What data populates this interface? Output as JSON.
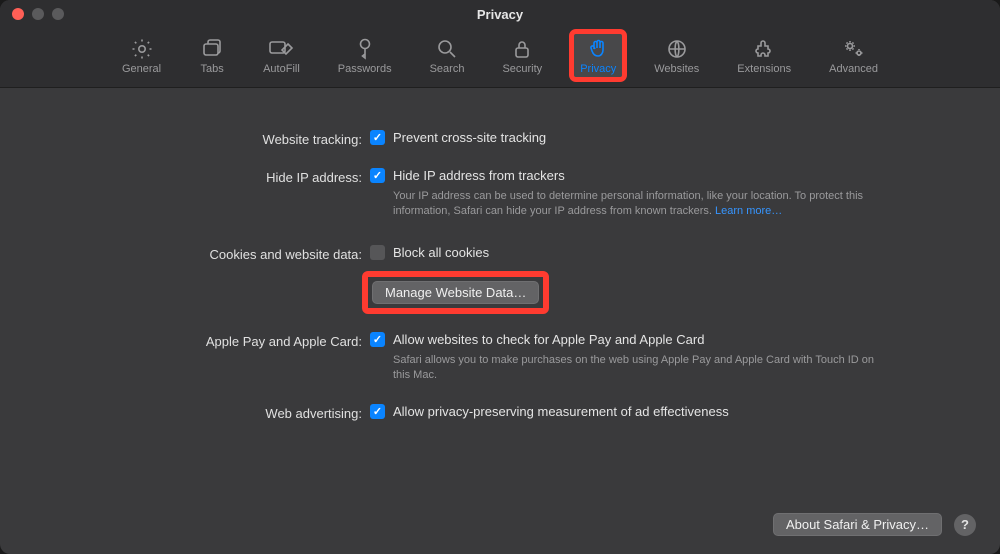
{
  "window": {
    "title": "Privacy"
  },
  "tabs": [
    {
      "id": "general",
      "label": "General"
    },
    {
      "id": "tabs",
      "label": "Tabs"
    },
    {
      "id": "autofill",
      "label": "AutoFill"
    },
    {
      "id": "passwords",
      "label": "Passwords"
    },
    {
      "id": "search",
      "label": "Search"
    },
    {
      "id": "security",
      "label": "Security"
    },
    {
      "id": "privacy",
      "label": "Privacy",
      "active": true
    },
    {
      "id": "websites",
      "label": "Websites"
    },
    {
      "id": "extensions",
      "label": "Extensions"
    },
    {
      "id": "advanced",
      "label": "Advanced"
    }
  ],
  "sections": {
    "tracking": {
      "label": "Website tracking:",
      "checkbox": {
        "checked": true,
        "label": "Prevent cross-site tracking"
      }
    },
    "hideip": {
      "label": "Hide IP address:",
      "checkbox": {
        "checked": true,
        "label": "Hide IP address from trackers"
      },
      "helper": "Your IP address can be used to determine personal information, like your location. To protect this information, Safari can hide your IP address from known trackers. ",
      "learnmore": "Learn more…"
    },
    "cookies": {
      "label": "Cookies and website data:",
      "checkbox": {
        "checked": false,
        "label": "Block all cookies"
      },
      "button": "Manage Website Data…"
    },
    "applepay": {
      "label": "Apple Pay and Apple Card:",
      "checkbox": {
        "checked": true,
        "label": "Allow websites to check for Apple Pay and Apple Card"
      },
      "helper": "Safari allows you to make purchases on the web using Apple Pay and Apple Card with Touch ID on this Mac."
    },
    "webad": {
      "label": "Web advertising:",
      "checkbox": {
        "checked": true,
        "label": "Allow privacy-preserving measurement of ad effectiveness"
      }
    }
  },
  "footer": {
    "about": "About Safari & Privacy…",
    "help": "?"
  }
}
